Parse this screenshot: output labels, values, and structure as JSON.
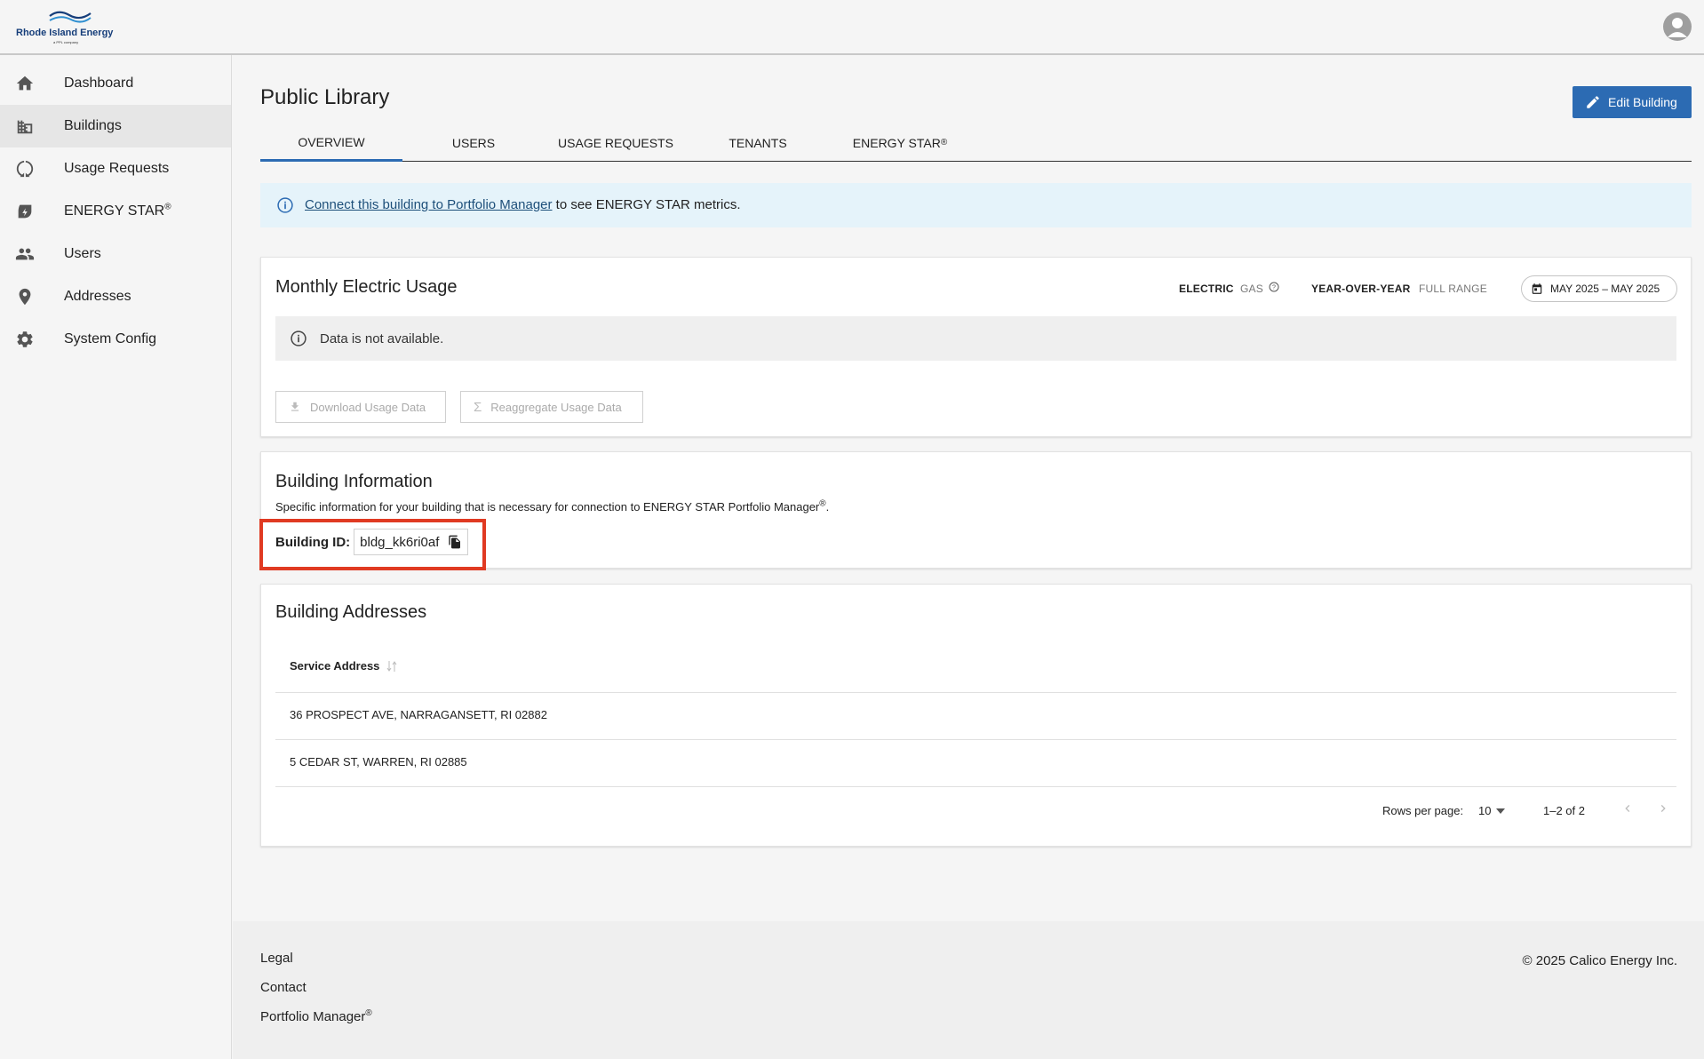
{
  "brand": {
    "name": "Rhode Island Energy",
    "subtitle": "a PPL company"
  },
  "sidebar": {
    "items": [
      {
        "label": "Dashboard",
        "icon": "home-icon"
      },
      {
        "label": "Buildings",
        "icon": "building-icon",
        "active": true
      },
      {
        "label": "Usage Requests",
        "icon": "cycle-icon"
      },
      {
        "label": "ENERGY STAR",
        "sup": "®",
        "icon": "leaf-icon"
      },
      {
        "label": "Users",
        "icon": "people-icon"
      },
      {
        "label": "Addresses",
        "icon": "location-pin-icon"
      },
      {
        "label": "System Config",
        "icon": "gear-icon"
      }
    ]
  },
  "page": {
    "title": "Public Library",
    "edit_label": "Edit Building"
  },
  "tabs": [
    {
      "label": "OVERVIEW",
      "active": true
    },
    {
      "label": "USERS"
    },
    {
      "label": "USAGE REQUESTS"
    },
    {
      "label": "TENANTS"
    },
    {
      "label": "ENERGY STAR",
      "sup": "®"
    }
  ],
  "banner": {
    "link_text": "Connect this building to Portfolio Manager",
    "rest_text": " to see ENERGY STAR metrics."
  },
  "usage": {
    "title": "Monthly Electric Usage",
    "electric": "ELECTRIC",
    "gas": "GAS",
    "year_over_year": "YEAR-OVER-YEAR",
    "full_range": "FULL RANGE",
    "date_range": "MAY 2025 – MAY 2025",
    "no_data": "Data is not available.",
    "download_label": "Download Usage Data",
    "reaggregate_label": "Reaggregate Usage Data"
  },
  "building_info": {
    "title": "Building Information",
    "description": "Specific information for your building that is necessary for connection to ENERGY STAR Portfolio Manager",
    "desc_sup": "®",
    "desc_end": ".",
    "id_label": "Building ID:",
    "id_value": "bldg_kk6ri0af"
  },
  "addresses": {
    "title": "Building Addresses",
    "column": "Service Address",
    "rows": [
      "36 PROSPECT AVE, NARRAGANSETT, RI 02882",
      "5 CEDAR ST, WARREN, RI 02885"
    ],
    "rows_per_page_label": "Rows per page:",
    "rows_per_page": "10",
    "range": "1–2 of 2"
  },
  "footer": {
    "links": [
      "Legal",
      "Contact",
      "Portfolio Manager"
    ],
    "portfolio_sup": "®",
    "copyright": "© 2025 Calico Energy Inc."
  },
  "colors": {
    "accent": "#2c6bb3",
    "highlight": "#e03a22",
    "banner_bg": "#e5f3fa",
    "brand_navy": "#163e7a"
  }
}
